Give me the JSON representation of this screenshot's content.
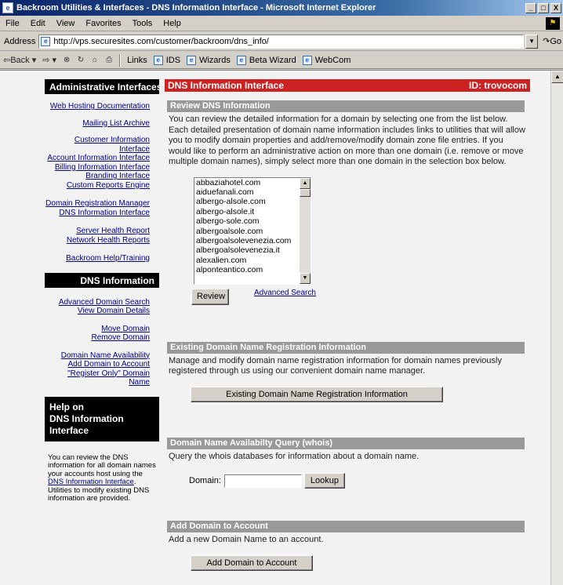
{
  "window": {
    "title": "Backroom Utilities & Interfaces - DNS Information Interface - Microsoft Internet Explorer",
    "controls": [
      "_",
      "□",
      "X"
    ]
  },
  "menu": [
    {
      "id": "file",
      "label": "File"
    },
    {
      "id": "edit",
      "label": "Edit"
    },
    {
      "id": "view",
      "label": "View"
    },
    {
      "id": "favorites",
      "label": "Favorites"
    },
    {
      "id": "tools",
      "label": "Tools"
    },
    {
      "id": "help",
      "label": "Help"
    }
  ],
  "address": {
    "label": "Address",
    "url": "http://vps.securesites.com/customer/backroom/dns_info/",
    "go_label": "Go"
  },
  "toolbar": {
    "back": "Back",
    "links_label": "Links",
    "links": [
      "IDS",
      "Wizards",
      "Beta Wizard",
      "WebCom"
    ]
  },
  "sidebar": {
    "admin_title": "Administrative Interfaces",
    "admin_links": [
      "Web Hosting Documentation",
      "Mailing List Archive",
      "Customer Information",
      "Interface",
      "Account Information Interface",
      "Billing Information Interface",
      "Branding Interface",
      "Custom Reports Engine",
      "Domain Registration Manager",
      "DNS Information Interface",
      "Server Health Report",
      "Network Health Reports",
      "Backroom Help/Training"
    ],
    "dns_title": "DNS Information",
    "dns_links": [
      "Advanced Domain Search",
      "View Domain Details",
      "Move Domain",
      "Remove Domain",
      "Domain Name Availability",
      "Add Domain to Account",
      "\"Register Only\" Domain Name"
    ],
    "help_title_1": "Help on",
    "help_title_2": "DNS Information",
    "help_title_3": "Interface",
    "help_text_before": "You can review the DNS information for all domain names your accounts host using the ",
    "help_link": "DNS Information Interface",
    "help_text_after": ". Utilities to modify existing DNS information are provided."
  },
  "main": {
    "title": "DNS Information Interface",
    "id_label": "ID: trovocom",
    "review": {
      "heading": "Review DNS Information",
      "text": "You can review the detailed information for a domain by selecting one from the list below. Each detailed presentation of domain name information includes links to utilities that will allow you to modify domain properties and add/remove/modify domain zone file entries. If you would like to perform an administrative action on more than one domain (i.e. remove or move multiple domain names), simply select more than one domain in the selection box below.",
      "domains": [
        "abbaziahotel.com",
        "aiduefanali.com",
        "albergo-alsole.com",
        "albergo-alsole.it",
        "albergo-sole.com",
        "albergoalsole.com",
        "albergoalsolevenezia.com",
        "albergoalsolevenezia.it",
        "alexalien.com",
        "alponteantico.com"
      ],
      "button": "Review",
      "advanced_link": "Advanced Search"
    },
    "registration": {
      "heading": "Existing Domain Name Registration Information",
      "text": "Manage and modify domain name registration information for domain names previously registered through us using our convenient domain name manager.",
      "button": "Existing Domain Name Registration Information"
    },
    "whois": {
      "heading": "Domain Name Availabilty Query (whois)",
      "text": "Query the whois databases for information about a domain name.",
      "field_label": "Domain:",
      "field_value": "",
      "button": "Lookup"
    },
    "add_domain": {
      "heading": "Add Domain to Account",
      "text": "Add a new Domain Name to an account.",
      "button": "Add Domain to Account"
    }
  }
}
